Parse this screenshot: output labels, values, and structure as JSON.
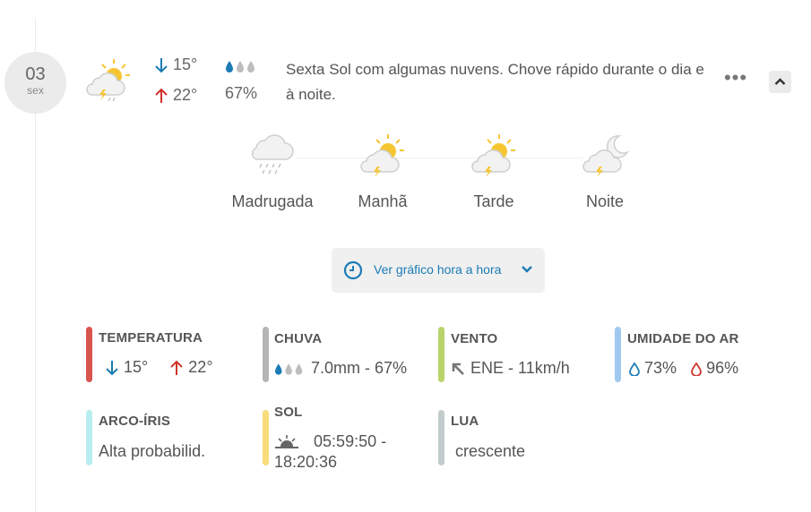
{
  "day": {
    "date_number": "03",
    "weekday_abbr": "sex"
  },
  "summary": {
    "temp_min": "15°",
    "temp_max": "22°",
    "rain_probability": "67%",
    "description": "Sexta Sol com algumas nuvens. Chove rápido durante o dia e à noite.",
    "more_label": "•••"
  },
  "periods": [
    {
      "label": "Madrugada",
      "icon": "rain-cloud-icon"
    },
    {
      "label": "Manhã",
      "icon": "sun-cloud-thunder-icon"
    },
    {
      "label": "Tarde",
      "icon": "sun-cloud-thunder-icon"
    },
    {
      "label": "Noite",
      "icon": "moon-cloud-thunder-icon"
    }
  ],
  "hourly_button": {
    "label": "Ver gráfico hora a hora"
  },
  "details": {
    "temperature": {
      "title": "TEMPERATURA",
      "min": "15°",
      "max": "22°",
      "color": "#d9534f"
    },
    "rain": {
      "title": "CHUVA",
      "value": "7.0mm - 67%",
      "color": "#b5b5b5"
    },
    "wind": {
      "title": "VENTO",
      "value": "ENE - 11km/h",
      "color": "#b8d36b"
    },
    "humidity": {
      "title": "UMIDADE DO AR",
      "min": "73%",
      "max": "96%",
      "color": "#9fcaf0"
    },
    "rainbow": {
      "title": "ARCO-ÍRIS",
      "value": "Alta probabilid.",
      "color": "#b9eef0"
    },
    "sun": {
      "title": "SOL",
      "sunrise": "05:59:50 -",
      "sunset": "18:20:36",
      "color": "#f7dc7a"
    },
    "moon": {
      "title": "LUA",
      "value": "crescente",
      "color": "#c3cccc"
    }
  },
  "colors": {
    "accent_blue": "#1b7bb5",
    "accent_red": "#d0332b",
    "sun_yellow": "#f6c532"
  }
}
